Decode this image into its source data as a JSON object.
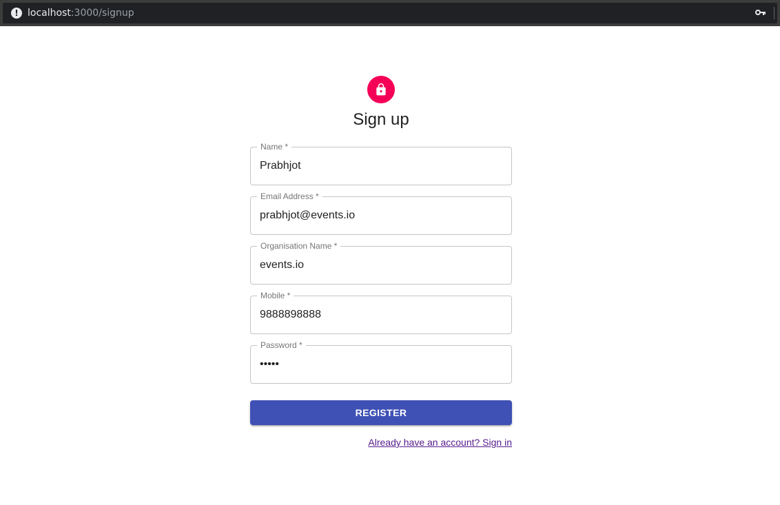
{
  "browser": {
    "host": "localhost",
    "path": ":3000/signup",
    "info_icon": "info-icon",
    "key_icon": "key-icon"
  },
  "form": {
    "avatar_icon": "lock-icon",
    "avatar_color": "#f50057",
    "title": "Sign up",
    "fields": [
      {
        "label": "Name *",
        "value": "Prabhjot"
      },
      {
        "label": "Email Address *",
        "value": "prabhjot@events.io"
      },
      {
        "label": "Organisation Name *",
        "value": "events.io"
      },
      {
        "label": "Mobile *",
        "value": "9888898888"
      },
      {
        "label": "Password *",
        "value": "•••••"
      }
    ],
    "register_label": "REGISTER",
    "register_color": "#3f51b5",
    "signin_link": "Already have an account? Sign in"
  }
}
